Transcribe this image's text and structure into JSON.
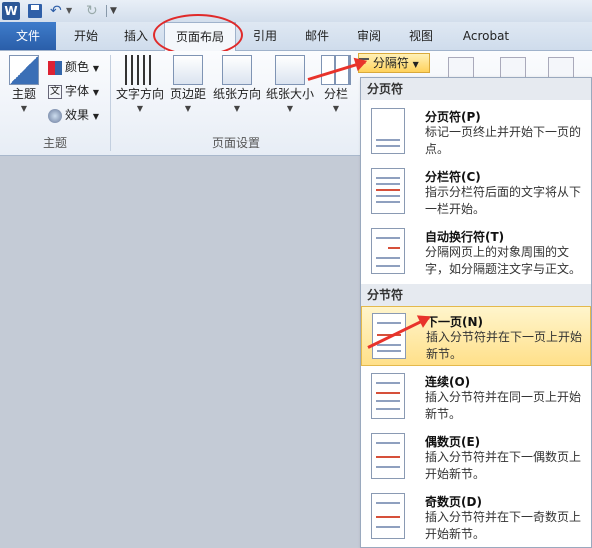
{
  "titlebar": {
    "logo": "W"
  },
  "tabs": [
    {
      "label": "文件"
    },
    {
      "label": "开始"
    },
    {
      "label": "插入"
    },
    {
      "label": "页面布局"
    },
    {
      "label": "引用"
    },
    {
      "label": "邮件"
    },
    {
      "label": "审阅"
    },
    {
      "label": "视图"
    },
    {
      "label": "Acrobat"
    }
  ],
  "ribbon": {
    "themes": {
      "theme_label": "主题",
      "colors_label": "颜色",
      "fonts_label": "字体",
      "effects_label": "效果",
      "group_label": "主题"
    },
    "page_setup": {
      "text_direction": "文字方向",
      "margins": "页边距",
      "orientation": "纸张方向",
      "size": "纸张大小",
      "columns": "分栏",
      "group_label": "页面设置"
    },
    "breaks_button": "分隔符"
  },
  "dropdown": {
    "page_breaks_header": "分页符",
    "section_breaks_header": "分节符",
    "items": [
      {
        "title": "分页符(P)",
        "desc": "标记一页终止并开始下一页的点。"
      },
      {
        "title": "分栏符(C)",
        "desc": "指示分栏符后面的文字将从下一栏开始。"
      },
      {
        "title": "自动换行符(T)",
        "desc": "分隔网页上的对象周围的文字，如分隔题注文字与正文。"
      },
      {
        "title": "下一页(N)",
        "desc": "插入分节符并在下一页上开始新节。"
      },
      {
        "title": "连续(O)",
        "desc": "插入分节符并在同一页上开始新节。"
      },
      {
        "title": "偶数页(E)",
        "desc": "插入分节符并在下一偶数页上开始新节。"
      },
      {
        "title": "奇数页(D)",
        "desc": "插入分节符并在下一奇数页上开始新节。"
      }
    ]
  },
  "colors": {
    "accent": "#2a5ea9",
    "highlight": "#ffe08a",
    "annotation": "#e8332b"
  }
}
